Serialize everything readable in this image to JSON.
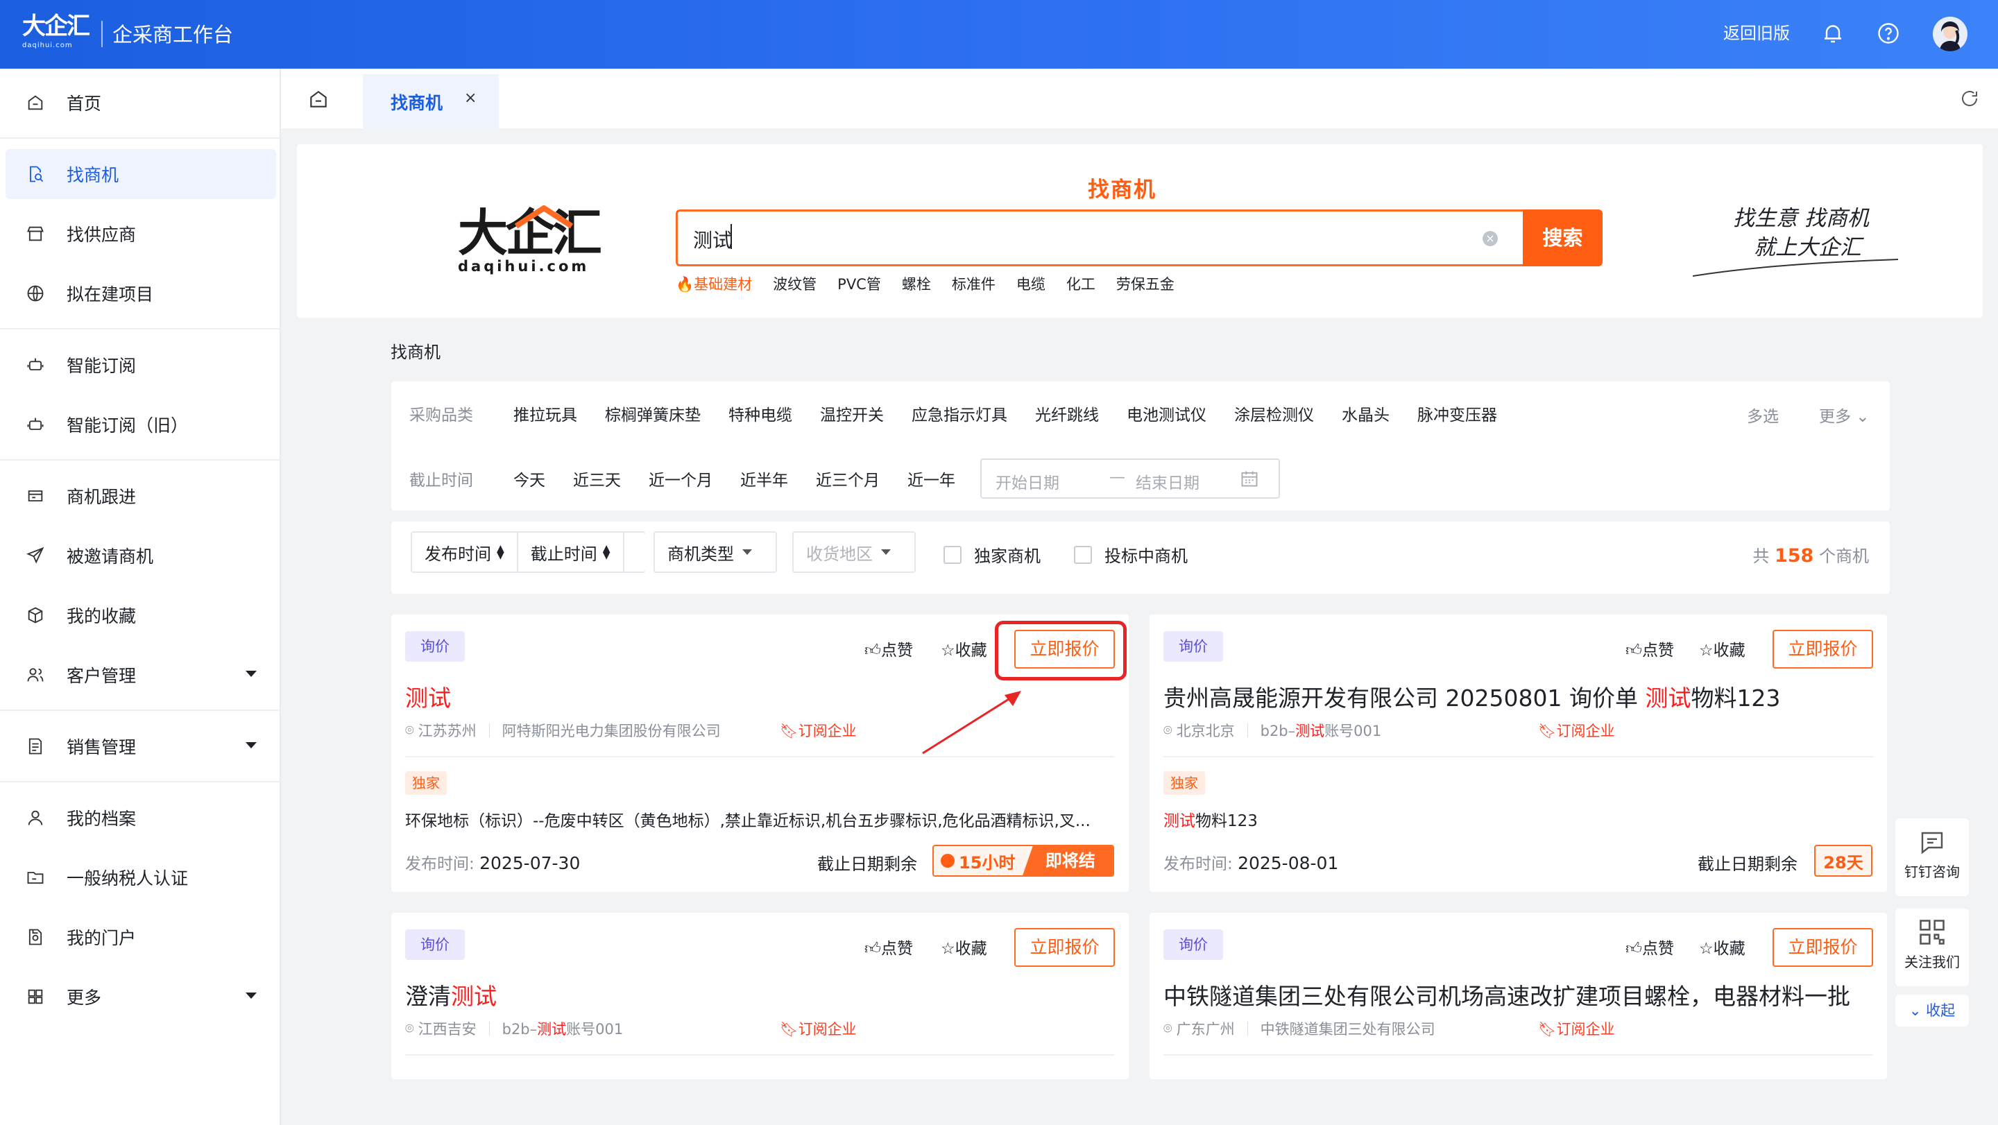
{
  "header": {
    "logo_text": "大企汇",
    "logo_sub": "daqihui.com",
    "title": "企采商工作台",
    "back_label": "返回旧版",
    "icons": [
      "bell-icon",
      "help-icon",
      "avatar"
    ]
  },
  "sidebar": {
    "items": [
      {
        "label": "首页",
        "icon": "home-icon"
      },
      {
        "label": "找商机",
        "icon": "search-doc-icon"
      },
      {
        "label": "找供应商",
        "icon": "store-icon"
      },
      {
        "label": "拟在建项目",
        "icon": "globe-icon"
      },
      {
        "label": "智能订阅",
        "icon": "robot-icon"
      },
      {
        "label": "智能订阅（旧）",
        "icon": "robot-icon"
      },
      {
        "label": "商机跟进",
        "icon": "follow-icon"
      },
      {
        "label": "被邀请商机",
        "icon": "send-icon"
      },
      {
        "label": "我的收藏",
        "icon": "box-icon"
      },
      {
        "label": "客户管理",
        "icon": "users-icon"
      },
      {
        "label": "销售管理",
        "icon": "sales-icon"
      },
      {
        "label": "我的档案",
        "icon": "user-icon"
      },
      {
        "label": "一般纳税人认证",
        "icon": "folder-icon"
      },
      {
        "label": "我的门户",
        "icon": "portal-icon"
      },
      {
        "label": "更多",
        "icon": "grid-icon"
      }
    ]
  },
  "tabs": {
    "active_label": "找商机",
    "close": "×"
  },
  "hero": {
    "logo_text": "大企汇",
    "logo_sub": "daqihui.com",
    "search_title": "找商机",
    "search_value": "测试",
    "search_button": "搜索",
    "hot_keywords": [
      "基础建材",
      "波纹管",
      "PVC管",
      "螺栓",
      "标准件",
      "电缆",
      "化工",
      "劳保五金"
    ],
    "slogan_line1": "找生意 找商机",
    "slogan_line2": "就上大企汇"
  },
  "section_title": "找商机",
  "filters": {
    "category_label": "采购品类",
    "categories": [
      "推拉玩具",
      "棕榈弹簧床垫",
      "特种电缆",
      "温控开关",
      "应急指示灯具",
      "光纤跳线",
      "电池测试仪",
      "涂层检测仪",
      "水晶头",
      "脉冲变压器"
    ],
    "multi_select": "多选",
    "more": "更多",
    "deadline_label": "截止时间",
    "deadlines": [
      "今天",
      "近三天",
      "近一个月",
      "近半年",
      "近三个月",
      "近一年"
    ],
    "start_placeholder": "开始日期",
    "end_placeholder": "结束日期",
    "range_sep": "—"
  },
  "sortbar": {
    "publish_time": "发布时间",
    "deadline": "截止时间",
    "type": "商机类型",
    "region": "收货地区",
    "exclusive": "独家商机",
    "bidding": "投标中商机",
    "count_prefix": "共",
    "count": "158",
    "count_suffix": "个商机"
  },
  "cards": [
    {
      "tag": "询价",
      "like": "点赞",
      "fav": "收藏",
      "quote": "立即报价",
      "title_pre": "",
      "title_hl": "测试",
      "title_post": "",
      "location": "江苏苏州",
      "company_pre": "阿特斯阳光电力集团股份有限公司",
      "company_hl": "",
      "company_post": "",
      "subscribe": "订阅企业",
      "exclusive": "独家",
      "desc_hl": "",
      "desc": "环保地标（标识）--危废中转区（黄色地标）,禁止靠近标识,机台五步骤标识,危化品酒精标识,叉...",
      "pub_label": "发布时间:",
      "pub_date": "2025-07-30",
      "remain_label": "截止日期剩余",
      "countdown": "15小时",
      "ending": "即将结束"
    },
    {
      "tag": "询价",
      "like": "点赞",
      "fav": "收藏",
      "quote": "立即报价",
      "title_pre": "贵州高晟能源开发有限公司 20250801 询价单 ",
      "title_hl": "测试",
      "title_post": "物料123",
      "location": "北京北京",
      "company_pre": "b2b–",
      "company_hl": "测试",
      "company_post": "账号001",
      "subscribe": "订阅企业",
      "exclusive": "独家",
      "desc_hl": "测试",
      "desc": "物料123",
      "pub_label": "发布时间:",
      "pub_date": "2025-08-01",
      "remain_label": "截止日期剩余",
      "countdown": "28天"
    },
    {
      "tag": "询价",
      "like": "点赞",
      "fav": "收藏",
      "quote": "立即报价",
      "title_pre": "澄清",
      "title_hl": "测试",
      "title_post": "",
      "location": "江西吉安",
      "company_pre": "b2b–",
      "company_hl": "测试",
      "company_post": "账号001",
      "subscribe": "订阅企业"
    },
    {
      "tag": "询价",
      "like": "点赞",
      "fav": "收藏",
      "quote": "立即报价",
      "title_pre": "中铁隧道集团三处有限公司机场高速改扩建项目螺栓，电器材料一批",
      "title_hl": "",
      "title_post": "",
      "location": "广东广州",
      "company_pre": "中铁隧道集团三处有限公司",
      "company_hl": "",
      "company_post": "",
      "subscribe": "订阅企业"
    }
  ],
  "float_panel": {
    "consult": "钉钉咨询",
    "follow": "关注我们",
    "collapse": "收起"
  },
  "colors": {
    "brand_blue": "#1c5ee0",
    "accent_orange": "#ff5d12",
    "highlight_red": "#ff1c1c",
    "annotation_red": "#e82424"
  }
}
